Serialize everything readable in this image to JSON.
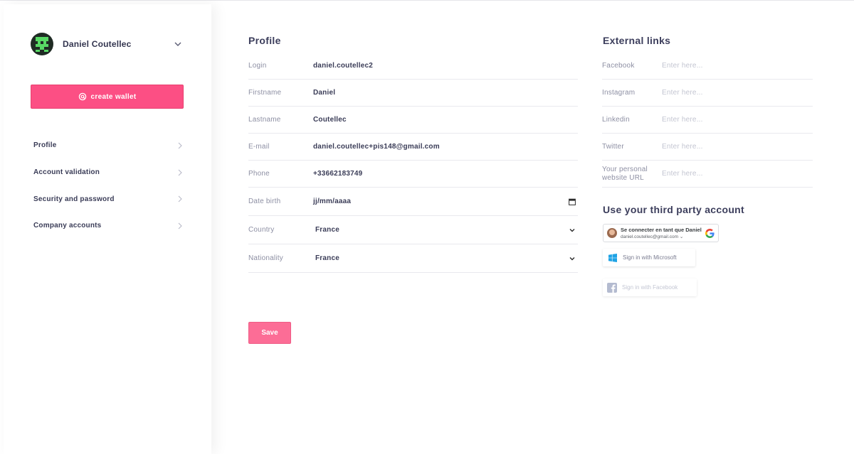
{
  "sidebar": {
    "user_name": "Daniel Coutellec",
    "create_wallet_label": "create wallet",
    "nav": [
      {
        "label": "Profile"
      },
      {
        "label": "Account validation"
      },
      {
        "label": "Security and password"
      },
      {
        "label": "Company accounts"
      }
    ]
  },
  "profile": {
    "title": "Profile",
    "fields": [
      {
        "label": "Login",
        "value": "daniel.coutellec2"
      },
      {
        "label": "Firstname",
        "value": "Daniel"
      },
      {
        "label": "Lastname",
        "value": "Coutellec"
      },
      {
        "label": "E-mail",
        "value": "daniel.coutellec+pis148@gmail.com"
      },
      {
        "label": "Phone",
        "value": "+33662183749"
      },
      {
        "label": "Date birth",
        "value": "jj/mm/aaaa"
      },
      {
        "label": "Country",
        "value": "France"
      },
      {
        "label": "Nationality",
        "value": "France"
      }
    ],
    "save_label": "Save"
  },
  "external_links": {
    "title": "External links",
    "placeholder": "Enter here...",
    "fields": [
      {
        "label": "Facebook"
      },
      {
        "label": "Instagram"
      },
      {
        "label": "Linkedin"
      },
      {
        "label": "Twitter"
      },
      {
        "label": "Your personal website URL"
      }
    ]
  },
  "third_party": {
    "title": "Use your third party account",
    "google_line1": "Se connecter en tant que Daniel",
    "google_line2": "daniel.coutellec@gmail.com",
    "microsoft_label": "Sign in with Microsoft",
    "facebook_label": "Sign in with Facebook"
  },
  "colors": {
    "accent": "#fc4f84",
    "save": "#fc6d96",
    "text": "#3a3c57",
    "muted": "#8d8fa3"
  }
}
